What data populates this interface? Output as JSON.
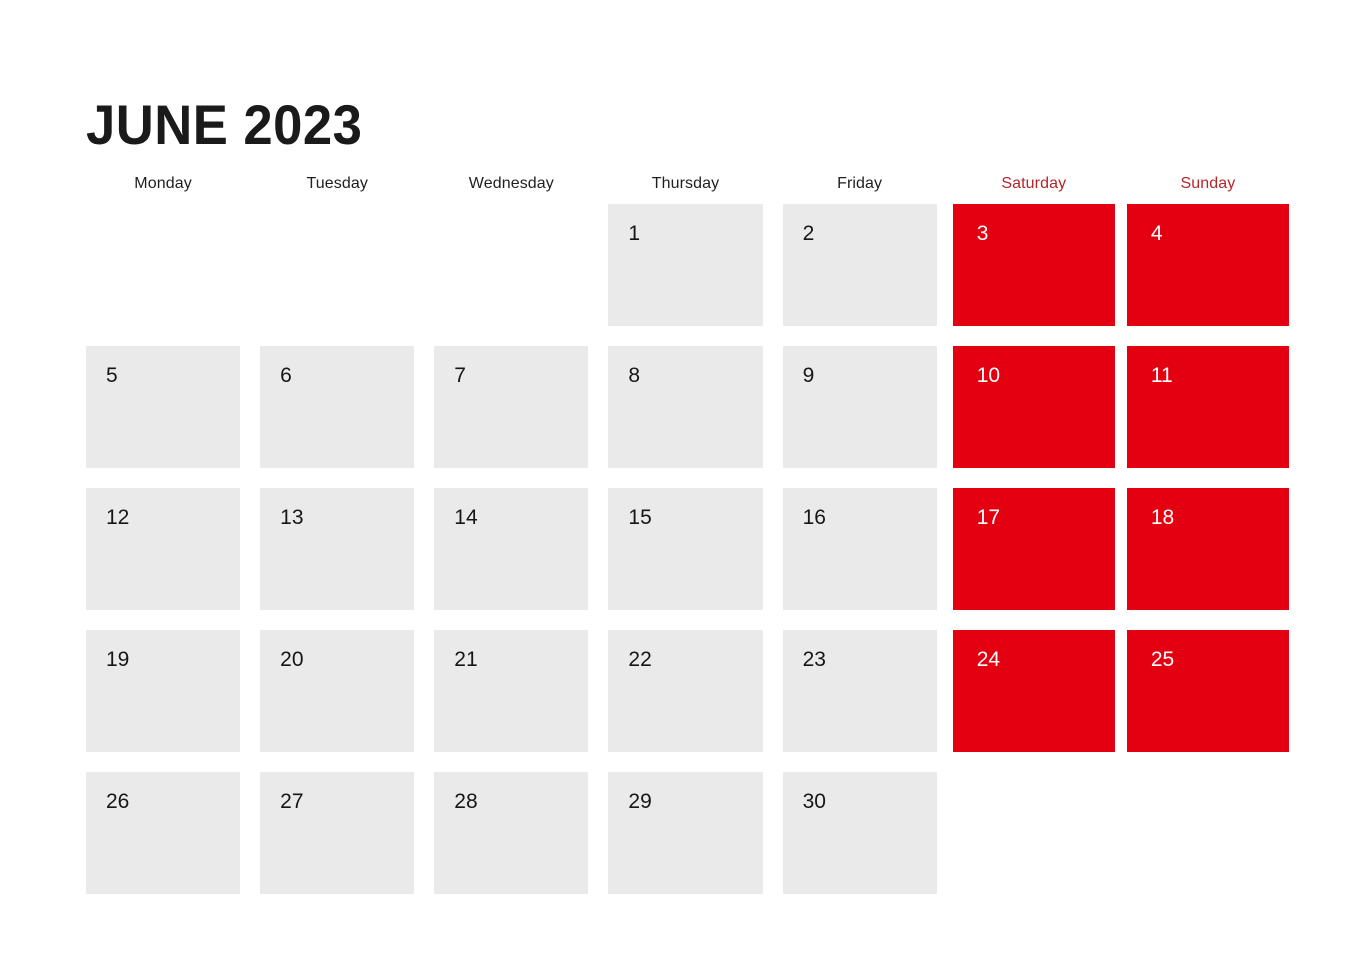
{
  "calendar": {
    "title": "JUNE 2023",
    "month": "June",
    "year": "2023",
    "colors": {
      "weekend_fill": "#e30011",
      "weekday_fill": "#eaeaea",
      "weekend_header_text": "#b3262a",
      "weekday_header_text": "#1f1f1f",
      "title_text": "#1a1a1a",
      "background": "#ffffff",
      "weekend_number_text": "#ffffff",
      "weekday_number_text": "#161616"
    },
    "weekdays": [
      {
        "label": "Monday",
        "weekend": false
      },
      {
        "label": "Tuesday",
        "weekend": false
      },
      {
        "label": "Wednesday",
        "weekend": false
      },
      {
        "label": "Thursday",
        "weekend": false
      },
      {
        "label": "Friday",
        "weekend": false
      },
      {
        "label": "Saturday",
        "weekend": true
      },
      {
        "label": "Sunday",
        "weekend": true
      }
    ],
    "cells": [
      {
        "day": "",
        "weekend": false,
        "empty": true
      },
      {
        "day": "",
        "weekend": false,
        "empty": true
      },
      {
        "day": "",
        "weekend": false,
        "empty": true
      },
      {
        "day": "1",
        "weekend": false,
        "empty": false
      },
      {
        "day": "2",
        "weekend": false,
        "empty": false
      },
      {
        "day": "3",
        "weekend": true,
        "empty": false
      },
      {
        "day": "4",
        "weekend": true,
        "empty": false
      },
      {
        "day": "5",
        "weekend": false,
        "empty": false
      },
      {
        "day": "6",
        "weekend": false,
        "empty": false
      },
      {
        "day": "7",
        "weekend": false,
        "empty": false
      },
      {
        "day": "8",
        "weekend": false,
        "empty": false
      },
      {
        "day": "9",
        "weekend": false,
        "empty": false
      },
      {
        "day": "10",
        "weekend": true,
        "empty": false
      },
      {
        "day": "11",
        "weekend": true,
        "empty": false
      },
      {
        "day": "12",
        "weekend": false,
        "empty": false
      },
      {
        "day": "13",
        "weekend": false,
        "empty": false
      },
      {
        "day": "14",
        "weekend": false,
        "empty": false
      },
      {
        "day": "15",
        "weekend": false,
        "empty": false
      },
      {
        "day": "16",
        "weekend": false,
        "empty": false
      },
      {
        "day": "17",
        "weekend": true,
        "empty": false
      },
      {
        "day": "18",
        "weekend": true,
        "empty": false
      },
      {
        "day": "19",
        "weekend": false,
        "empty": false
      },
      {
        "day": "20",
        "weekend": false,
        "empty": false
      },
      {
        "day": "21",
        "weekend": false,
        "empty": false
      },
      {
        "day": "22",
        "weekend": false,
        "empty": false
      },
      {
        "day": "23",
        "weekend": false,
        "empty": false
      },
      {
        "day": "24",
        "weekend": true,
        "empty": false
      },
      {
        "day": "25",
        "weekend": true,
        "empty": false
      },
      {
        "day": "26",
        "weekend": false,
        "empty": false
      },
      {
        "day": "27",
        "weekend": false,
        "empty": false
      },
      {
        "day": "28",
        "weekend": false,
        "empty": false
      },
      {
        "day": "29",
        "weekend": false,
        "empty": false
      },
      {
        "day": "30",
        "weekend": false,
        "empty": false
      },
      {
        "day": "",
        "weekend": true,
        "empty": true
      },
      {
        "day": "",
        "weekend": true,
        "empty": true
      }
    ]
  }
}
